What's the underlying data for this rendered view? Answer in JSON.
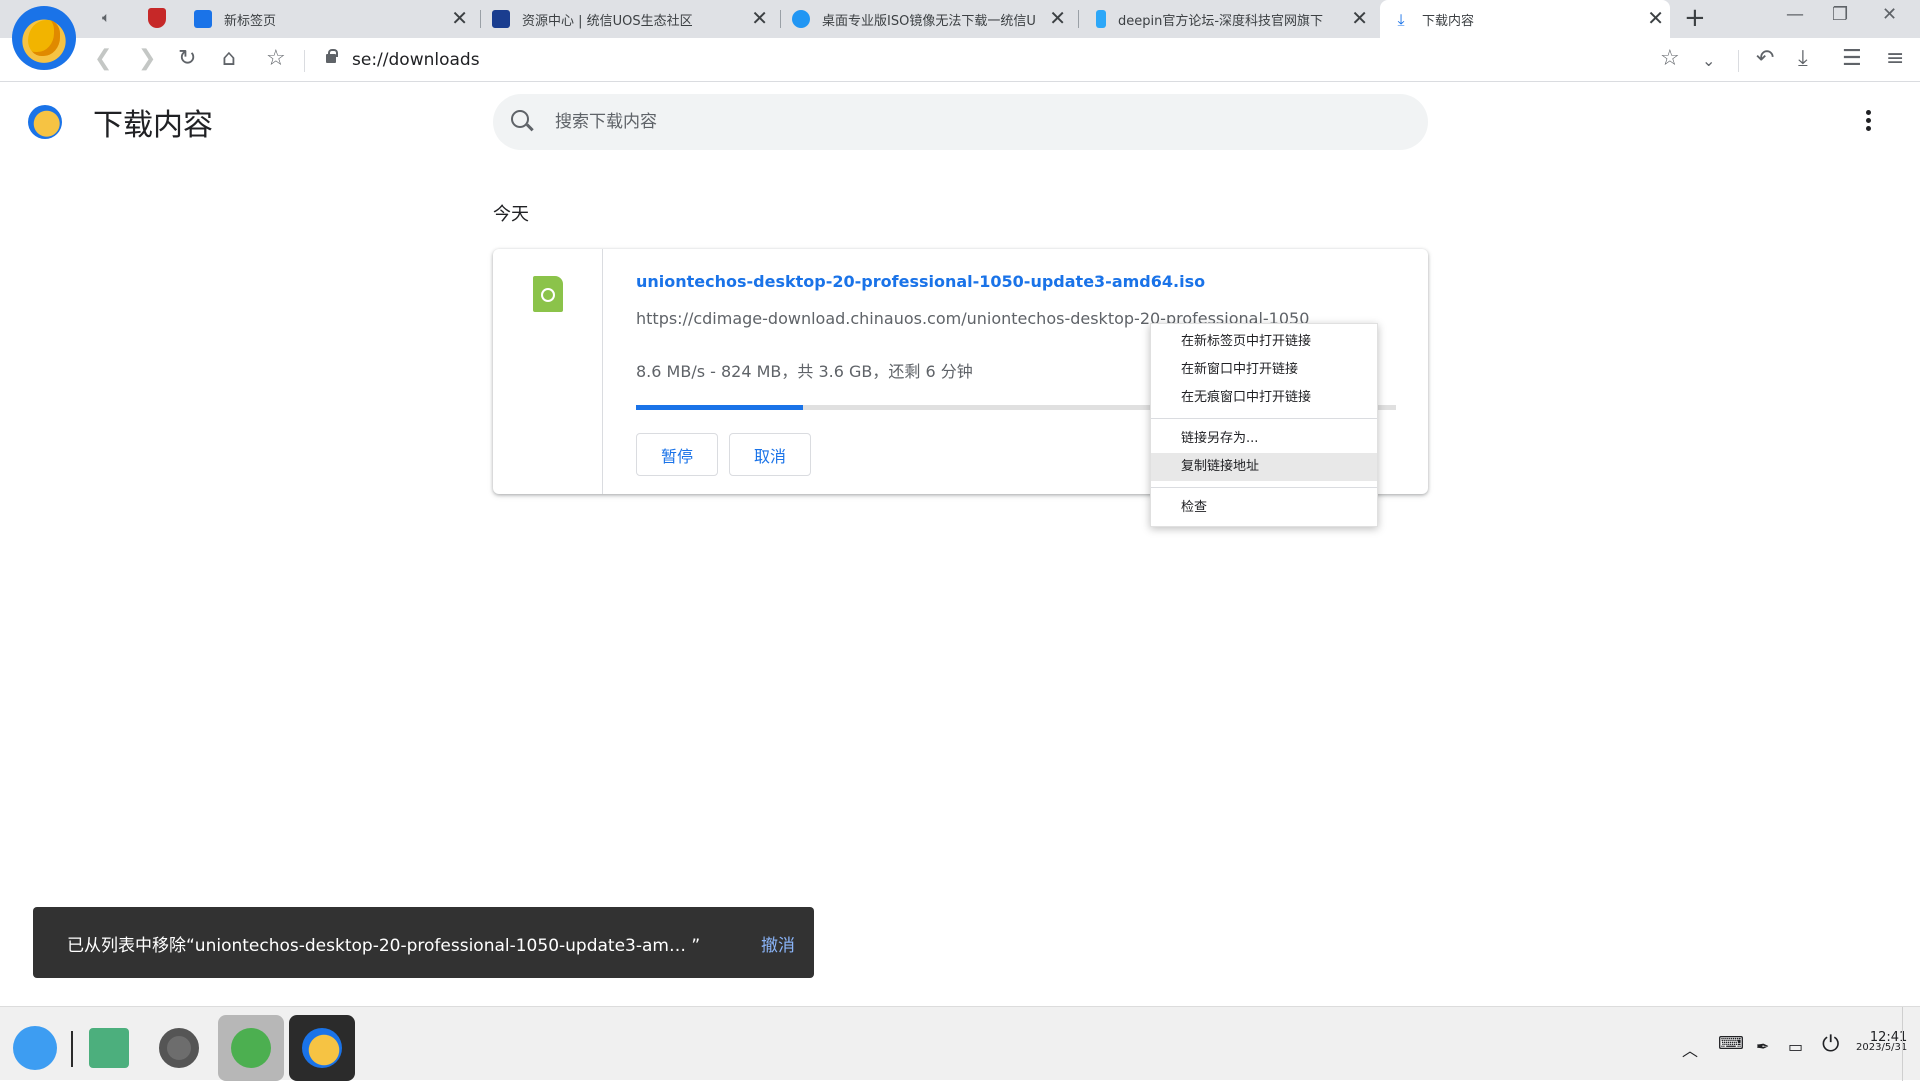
{
  "tabs": [
    {
      "label": "新标签页",
      "favicon": "person-icon",
      "color": "#1a73e8"
    },
    {
      "label": "资源中心 | 统信UOS生态社区",
      "favicon": "uos-logo-icon",
      "color": "#1a3d8f"
    },
    {
      "label": "桌面专业版ISO镜像无法下载一统信U",
      "favicon": "u-logo-icon",
      "color": "#2196f3"
    },
    {
      "label": "deepin官方论坛-深度科技官网旗下",
      "favicon": "deepin-icon",
      "color": "#2ca7f8"
    },
    {
      "label": "下载内容",
      "favicon": "download-icon",
      "color": "#1a73e8",
      "active": true
    }
  ],
  "address": {
    "text": "se://downloads"
  },
  "page": {
    "title": "下载内容",
    "search_placeholder": "搜索下载内容"
  },
  "downloads": {
    "section_date": "今天",
    "item": {
      "file_name": "uniontechos-desktop-20-professional-1050-update3-amd64.iso",
      "url": "https://cdimage-download.chinauos.com/uniontechos-desktop-20-professional-1050",
      "status": "8.6 MB/s - 824 MB，共 3.6 GB，还剩 6 分钟",
      "progress_percent": 22,
      "pause_label": "暂停",
      "cancel_label": "取消"
    }
  },
  "context_menu": {
    "items": [
      {
        "label": "在新标签页中打开链接"
      },
      {
        "label": "在新窗口中打开链接"
      },
      {
        "label": "在无痕窗口中打开链接"
      },
      {
        "label": "链接另存为..."
      },
      {
        "label": "复制链接地址"
      },
      {
        "label": "检查"
      }
    ]
  },
  "snackbar": {
    "text": "已从列表中移除“uniontechos-desktop-20-professional-1050-update3-am…  ”",
    "undo_label": "撤消"
  },
  "taskbar": {
    "apps": [
      "launcher-icon",
      "video-app-icon",
      "settings-icon",
      "wechat-icon",
      "browser-icon"
    ],
    "clock_time": "12:41",
    "clock_date": "2023/5/31"
  },
  "colors": {
    "accent": "#1a73e8",
    "tab_strip": "#dfe1e5",
    "snackbar": "#323232"
  }
}
